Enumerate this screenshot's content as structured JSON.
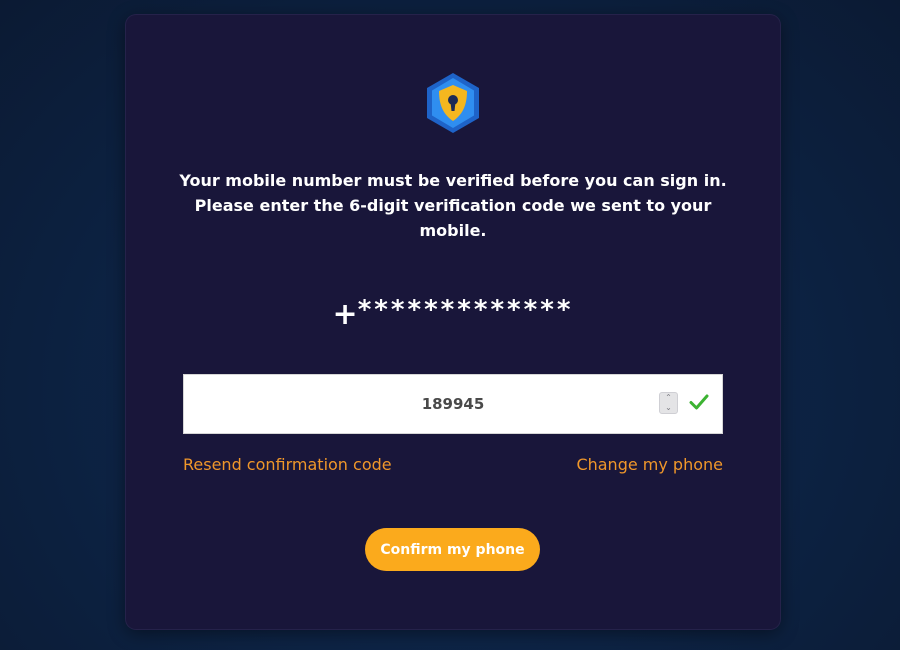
{
  "logo": {
    "icon": "shield-lock-icon",
    "colors": {
      "hex_outer": "#1e63c8",
      "hex_inner": "#2f8ef0",
      "shield": "#f4b71f",
      "keyhole": "#1c2a55"
    }
  },
  "message": {
    "line1": "Your mobile number must be verified before you can sign in.",
    "line2": "Please enter the 6-digit verification code we sent to your mobile."
  },
  "phone": {
    "prefix": "+",
    "masked": "*************"
  },
  "code_input": {
    "value": "189945",
    "spinner_icon": "spinner-arrows-icon",
    "valid_icon": "checkmark-icon",
    "valid_color": "#3cb332"
  },
  "links": {
    "resend": "Resend confirmation code",
    "change": "Change my phone"
  },
  "confirm_button": {
    "label": "Confirm my phone",
    "color": "#fbaa1c"
  }
}
